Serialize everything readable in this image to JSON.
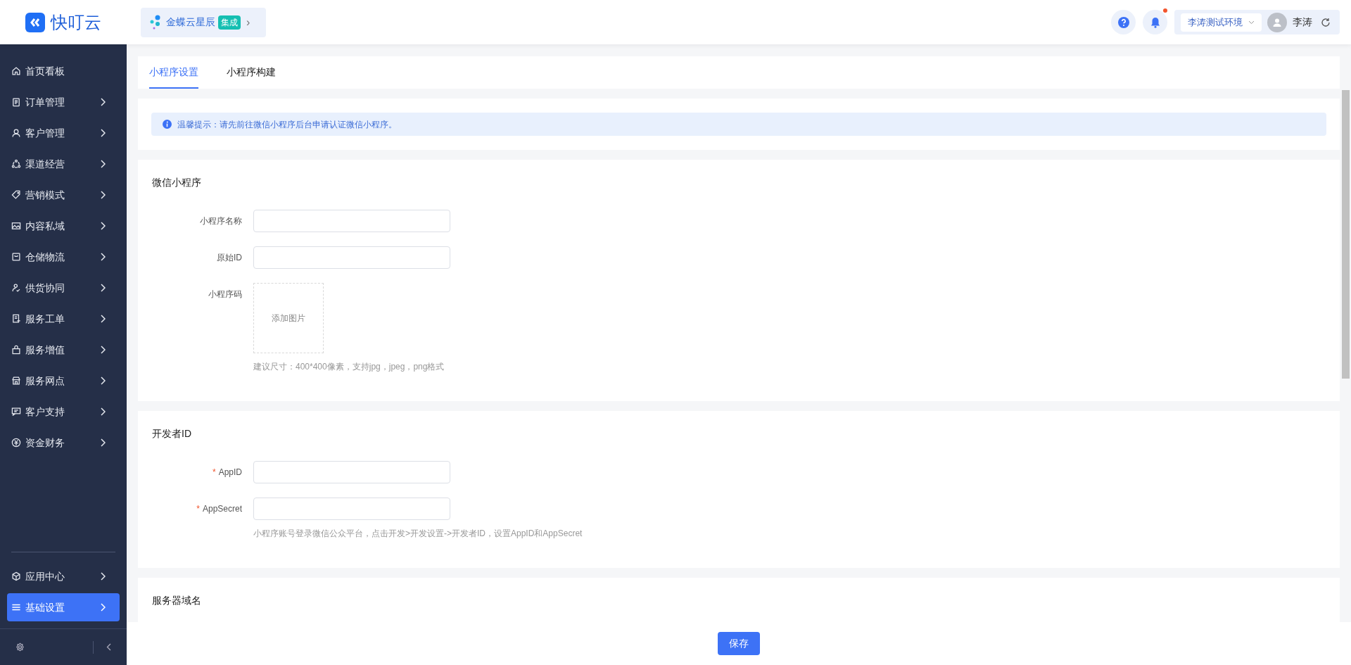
{
  "header": {
    "logo_text": "快叮云",
    "integration": {
      "label": "金蝶云星辰",
      "badge": "集成",
      "arrow": "›"
    },
    "notification_unread": true,
    "environment": "李涛测试环境",
    "user_name": "李涛"
  },
  "sidebar": {
    "items": [
      {
        "label": "首页看板",
        "expandable": false,
        "selected": false
      },
      {
        "label": "订单管理",
        "expandable": true,
        "selected": false
      },
      {
        "label": "客户管理",
        "expandable": true,
        "selected": false
      },
      {
        "label": "渠道经营",
        "expandable": true,
        "selected": false
      },
      {
        "label": "营销模式",
        "expandable": true,
        "selected": false
      },
      {
        "label": "内容私域",
        "expandable": true,
        "selected": false
      },
      {
        "label": "仓储物流",
        "expandable": true,
        "selected": false
      },
      {
        "label": "供货协同",
        "expandable": true,
        "selected": false
      },
      {
        "label": "服务工单",
        "expandable": true,
        "selected": false
      },
      {
        "label": "服务增值",
        "expandable": true,
        "selected": false
      },
      {
        "label": "服务网点",
        "expandable": true,
        "selected": false
      },
      {
        "label": "客户支持",
        "expandable": true,
        "selected": false
      },
      {
        "label": "资金财务",
        "expandable": true,
        "selected": false
      }
    ],
    "bottom_items": [
      {
        "label": "应用中心",
        "expandable": true,
        "selected": false
      },
      {
        "label": "基础设置",
        "expandable": true,
        "selected": true
      }
    ]
  },
  "tabs": [
    {
      "label": "小程序设置",
      "selected": true
    },
    {
      "label": "小程序构建",
      "selected": false
    }
  ],
  "notice": "温馨提示：请先前往微信小程序后台申请认证微信小程序。",
  "sections": [
    {
      "title": "微信小程序",
      "fields": [
        {
          "kind": "input",
          "label": "小程序名称"
        },
        {
          "kind": "input",
          "label": "原始ID"
        },
        {
          "kind": "upload",
          "label": "小程序码",
          "upload_text": "添加图片",
          "hint": "建议尺寸：400*400像素，支持jpg，jpeg，png格式"
        }
      ]
    },
    {
      "title": "开发者ID",
      "fields": [
        {
          "kind": "input",
          "label": "AppID",
          "required_mark": "*"
        },
        {
          "kind": "input",
          "label": "AppSecret",
          "required_mark": "*",
          "hint": "小程序账号登录微信公众平台，点击开发>开发设置->开发者ID，设置AppID和AppSecret"
        }
      ]
    },
    {
      "title": "服务器域名"
    }
  ],
  "save_button": "保存"
}
